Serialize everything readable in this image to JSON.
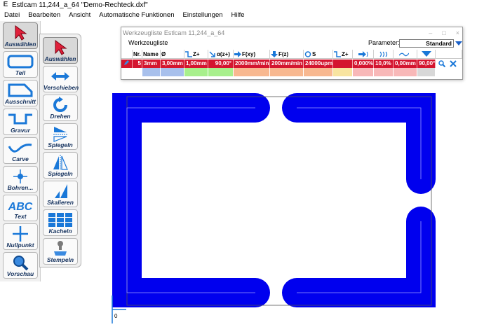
{
  "window": {
    "title": "Estlcam 11,244_a_64 \"Demo-Rechteck.dxf\"",
    "app_icon": "estlcam-icon"
  },
  "menu": [
    "Datei",
    "Bearbeiten",
    "Ansicht",
    "Automatische Funktionen",
    "Einstellungen",
    "Hilfe"
  ],
  "toolbar_left": [
    {
      "label": "Auswählen",
      "icon": "cursor-icon",
      "active": true
    },
    {
      "label": "Teil",
      "icon": "part-icon"
    },
    {
      "label": "Ausschnitt",
      "icon": "cutout-icon"
    },
    {
      "label": "Gravur",
      "icon": "engrave-icon"
    },
    {
      "label": "Carve",
      "icon": "carve-icon"
    },
    {
      "label": "Bohren...",
      "icon": "drill-icon"
    },
    {
      "label": "Text",
      "icon": "text-icon"
    },
    {
      "label": "Nullpunkt",
      "icon": "crosshair-icon"
    },
    {
      "label": "Vorschau",
      "icon": "magnifier-icon"
    }
  ],
  "toolbar_right": [
    {
      "label": "Auswählen",
      "icon": "cursor-icon",
      "active": true
    },
    {
      "label": "Verschieben",
      "icon": "move-arrows-icon"
    },
    {
      "label": "Drehen",
      "icon": "rotate-icon"
    },
    {
      "label": "Spiegeln",
      "icon": "mirror-horizontal-icon"
    },
    {
      "label": "Spiegeln",
      "icon": "mirror-vertical-icon"
    },
    {
      "label": "Skalieren",
      "icon": "scale-icon"
    },
    {
      "label": "Kacheln",
      "icon": "tile-icon"
    },
    {
      "label": "Stempeln",
      "icon": "stamp-icon"
    }
  ],
  "tool_window": {
    "title": "Werkzeugliste Estlcam 11,244_a_64",
    "controls": [
      "–",
      "□",
      "×"
    ],
    "tab": "Werkzeugliste",
    "parameter_label": "Parameter:",
    "parameter_value": "Standard",
    "headers": [
      "Nr.",
      "Name",
      "Ø",
      "Z+",
      "α(z+)",
      "F(xy)",
      "F(z)",
      "S",
      "Z+",
      "",
      "",
      "",
      ""
    ],
    "row": [
      "5",
      "3mm",
      "3,00mm",
      "1,00mm",
      "90,00°",
      "2000mm/min",
      "200mm/min",
      "24000upm",
      "",
      "0,000%",
      "10,0%",
      "0,00mm",
      "90,00°"
    ],
    "colors": {
      "row_bg": "#d4152f",
      "swatch_name": "#a8c0ec",
      "swatch_z": "#a8f08c",
      "swatch_feed": "#f8b890",
      "swatch_z2": "#f8e4a0",
      "swatch_pct": "#f8b8b8",
      "swatch_angle": "#d8d8d8"
    }
  },
  "drawing": {
    "toolpath_color": "#0000ee",
    "origin_label": "0"
  }
}
